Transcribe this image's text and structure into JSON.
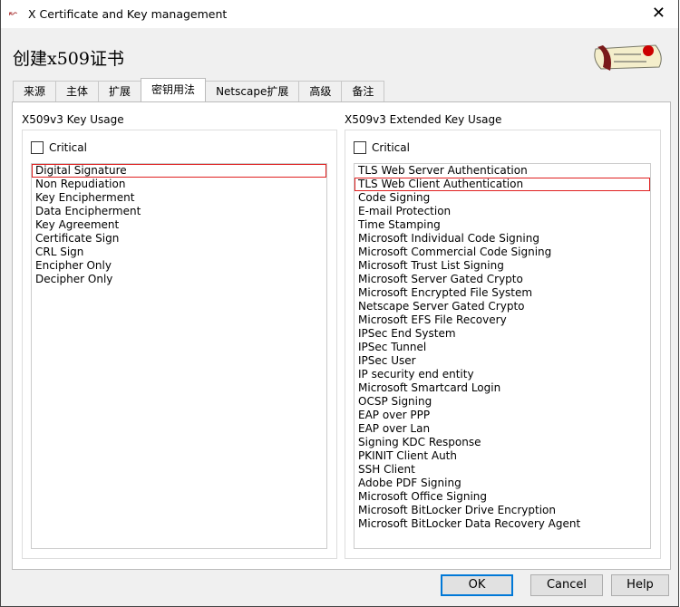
{
  "window": {
    "title": "X Certificate and Key management",
    "close_glyph": "✕"
  },
  "heading": "创建x509证书",
  "tabs": [
    {
      "label": "来源"
    },
    {
      "label": "主体"
    },
    {
      "label": "扩展"
    },
    {
      "label": "密钥用法",
      "active": true
    },
    {
      "label": "Netscape扩展"
    },
    {
      "label": "高级"
    },
    {
      "label": "备注"
    }
  ],
  "key_usage": {
    "label": "X509v3 Key Usage",
    "critical_label": "Critical",
    "critical_checked": false,
    "items": [
      "Digital Signature",
      "Non Repudiation",
      "Key Encipherment",
      "Data Encipherment",
      "Key Agreement",
      "Certificate Sign",
      "CRL Sign",
      "Encipher Only",
      "Decipher Only"
    ],
    "selected": 0
  },
  "ext_key_usage": {
    "label": "X509v3 Extended Key Usage",
    "critical_label": "Critical",
    "critical_checked": false,
    "items": [
      "TLS Web Server Authentication",
      "TLS Web Client Authentication",
      "Code Signing",
      "E-mail Protection",
      "Time Stamping",
      "Microsoft Individual Code Signing",
      "Microsoft Commercial Code Signing",
      "Microsoft Trust List Signing",
      "Microsoft Server Gated Crypto",
      "Microsoft Encrypted File System",
      "Netscape Server Gated Crypto",
      "Microsoft EFS File Recovery",
      "IPSec End System",
      "IPSec Tunnel",
      "IPSec User",
      "IP security end entity",
      "Microsoft Smartcard Login",
      "OCSP Signing",
      "EAP over PPP",
      "EAP over Lan",
      "Signing KDC Response",
      "PKINIT Client Auth",
      "SSH Client",
      "Adobe PDF Signing",
      "Microsoft Office Signing",
      "Microsoft BitLocker Drive Encryption",
      "Microsoft BitLocker Data Recovery Agent"
    ],
    "selected": 1
  },
  "buttons": {
    "ok": "OK",
    "cancel": "Cancel",
    "help": "Help"
  },
  "colors": {
    "selection_outline": "#e02020",
    "default_button": "#0078d7"
  }
}
